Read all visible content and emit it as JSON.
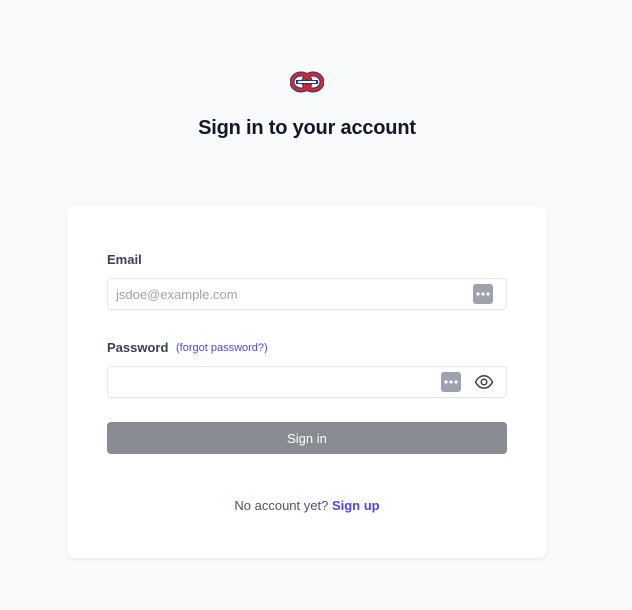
{
  "header": {
    "logo_icon": "knot-logo-icon",
    "title": "Sign in to your account"
  },
  "form": {
    "email_label": "Email",
    "email_value": "",
    "email_placeholder": "jsdoe@example.com",
    "password_label": "Password",
    "forgot_password_label": "(forgot password?)",
    "password_value": "",
    "password_placeholder": "",
    "autofill_icon": "password-manager-icon",
    "show_password_icon": "eye-icon",
    "submit_label": "Sign in"
  },
  "footer": {
    "prompt": "No account yet?",
    "signup_label": "Sign up"
  },
  "colors": {
    "background": "#f9fafb",
    "card": "#ffffff",
    "accent_link": "#4f46e5",
    "button_disabled": "#888b91",
    "logo_red": "#dc2626",
    "logo_blue": "#1e3a8a"
  }
}
